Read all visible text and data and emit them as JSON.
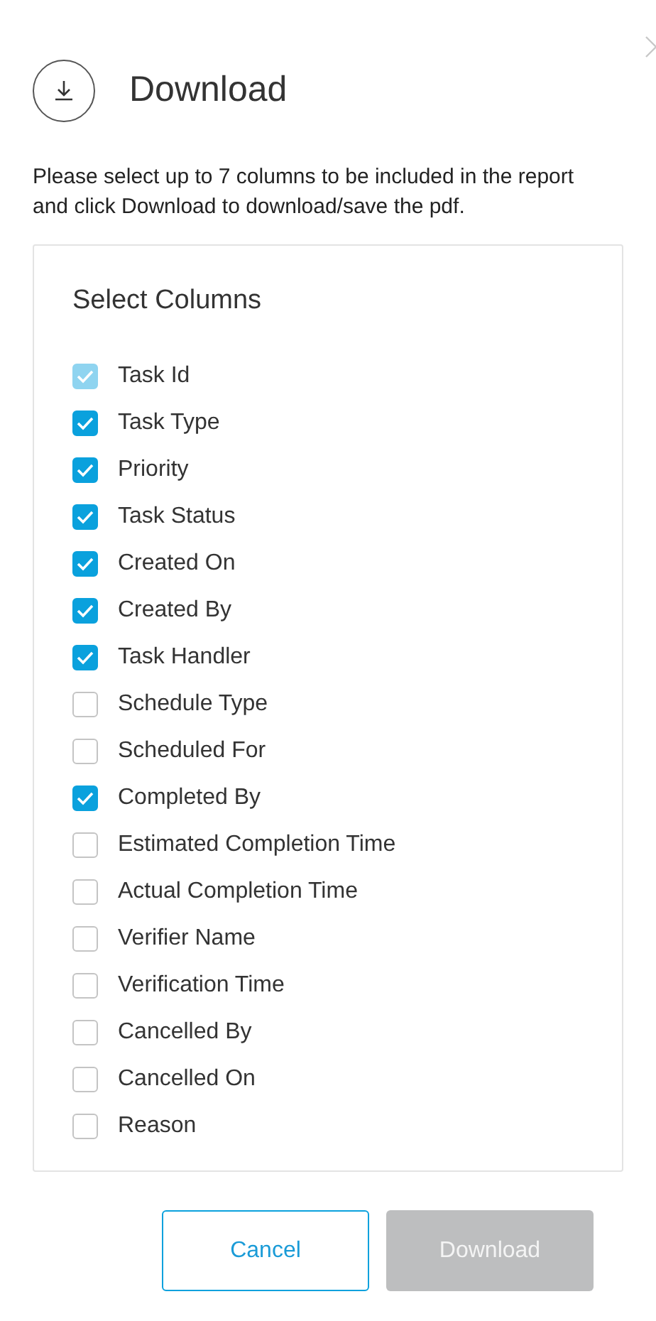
{
  "title": "Download",
  "instructions": "Please select up to 7 columns to be included in the report and click Download to download/save the pdf.",
  "section_title": "Select Columns",
  "columns": [
    {
      "label": "Task Id",
      "checked": true,
      "disabled": true
    },
    {
      "label": "Task Type",
      "checked": true,
      "disabled": false
    },
    {
      "label": "Priority",
      "checked": true,
      "disabled": false
    },
    {
      "label": "Task Status",
      "checked": true,
      "disabled": false
    },
    {
      "label": "Created On",
      "checked": true,
      "disabled": false
    },
    {
      "label": "Created By",
      "checked": true,
      "disabled": false
    },
    {
      "label": "Task Handler",
      "checked": true,
      "disabled": false
    },
    {
      "label": "Schedule Type",
      "checked": false,
      "disabled": false
    },
    {
      "label": "Scheduled For",
      "checked": false,
      "disabled": false
    },
    {
      "label": "Completed By",
      "checked": true,
      "disabled": false
    },
    {
      "label": "Estimated Completion Time",
      "checked": false,
      "disabled": false
    },
    {
      "label": "Actual Completion Time",
      "checked": false,
      "disabled": false
    },
    {
      "label": "Verifier Name",
      "checked": false,
      "disabled": false
    },
    {
      "label": "Verification Time",
      "checked": false,
      "disabled": false
    },
    {
      "label": "Cancelled By",
      "checked": false,
      "disabled": false
    },
    {
      "label": "Cancelled On",
      "checked": false,
      "disabled": false
    },
    {
      "label": "Reason",
      "checked": false,
      "disabled": false
    }
  ],
  "buttons": [
    {
      "label": "Cancel",
      "kind": "secondary",
      "disabled": false
    },
    {
      "label": "Download",
      "kind": "primary",
      "disabled": true
    }
  ]
}
